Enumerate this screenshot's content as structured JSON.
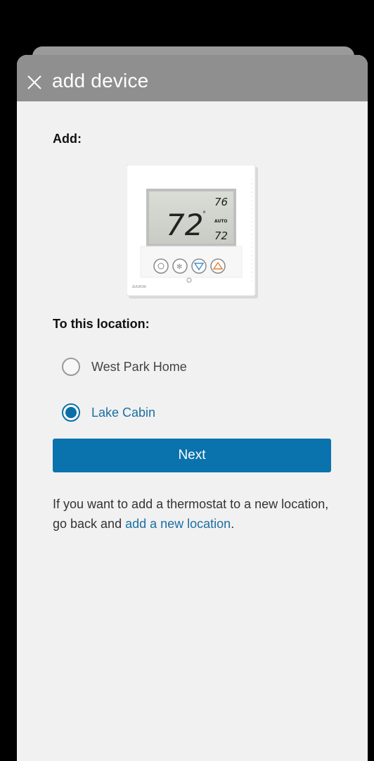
{
  "header": {
    "title": "add device",
    "close_icon": "close-icon"
  },
  "add_section": {
    "label": "Add:",
    "device_image": "thermostat",
    "display": {
      "current_temp": "72",
      "heat_setpoint": "76",
      "cool_setpoint": "72",
      "mode": "AUTO",
      "brand": "DAIKIN"
    }
  },
  "location_section": {
    "label": "To this location:",
    "options": [
      {
        "label": "West Park Home",
        "selected": false
      },
      {
        "label": "Lake Cabin",
        "selected": true
      }
    ]
  },
  "next_button": {
    "label": "Next"
  },
  "info": {
    "text_before": "If you want to add a thermostat to a new location, go back and ",
    "link_text": "add a new location",
    "text_after": "."
  },
  "colors": {
    "accent": "#0a73ad",
    "header_bg": "#8f8f8f",
    "sheet_bg": "#f1f1f1"
  }
}
